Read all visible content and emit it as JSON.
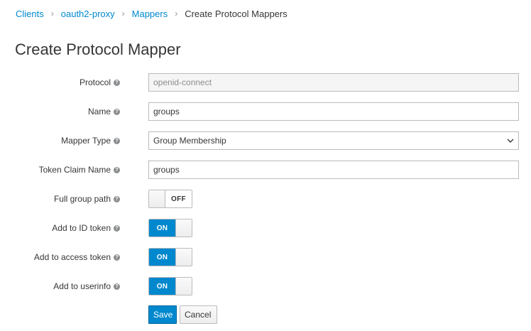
{
  "breadcrumb": {
    "items": [
      "Clients",
      "oauth2-proxy",
      "Mappers"
    ],
    "current": "Create Protocol Mappers"
  },
  "page_title": "Create Protocol Mapper",
  "form": {
    "protocol": {
      "label": "Protocol",
      "value": "openid-connect"
    },
    "name": {
      "label": "Name",
      "value": "groups"
    },
    "mapper_type": {
      "label": "Mapper Type",
      "value": "Group Membership"
    },
    "token_claim_name": {
      "label": "Token Claim Name",
      "value": "groups"
    },
    "full_group_path": {
      "label": "Full group path",
      "state": "OFF"
    },
    "add_to_id_token": {
      "label": "Add to ID token",
      "state": "ON"
    },
    "add_to_access_token": {
      "label": "Add to access token",
      "state": "ON"
    },
    "add_to_userinfo": {
      "label": "Add to userinfo",
      "state": "ON"
    }
  },
  "buttons": {
    "save": "Save",
    "cancel": "Cancel"
  },
  "icons": {
    "help": "question-circle-icon",
    "separator": "chevron-right-icon",
    "dropdown": "chevron-down-icon"
  },
  "colors": {
    "link": "#0088ce",
    "primary": "#0088ce",
    "text": "#363636",
    "muted": "#8b8d8f"
  }
}
